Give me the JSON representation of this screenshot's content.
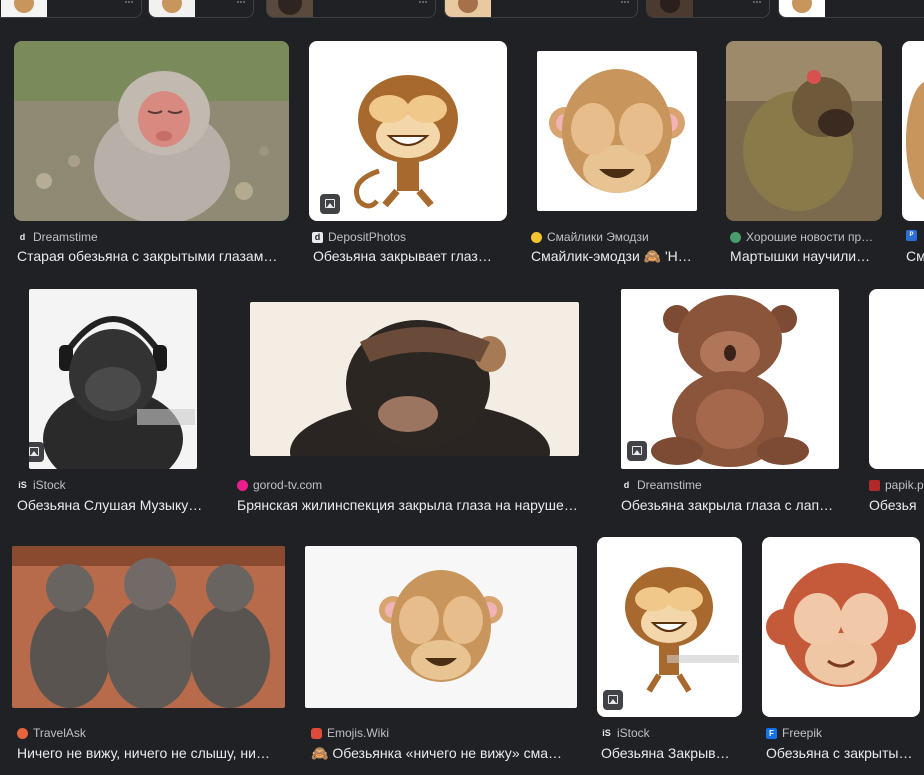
{
  "colors": {
    "background": "#202124",
    "text_primary": "#e8eaed",
    "text_secondary": "#bdc1c6"
  },
  "results": [
    {
      "source": "Dreamstime",
      "icon": "dreamstime-logo-icon",
      "title": "Старая обезьяна с закрытыми глазам…"
    },
    {
      "source": "DepositPhotos",
      "icon": "depositphotos-logo-icon",
      "title": "Обезьяна закрывает глаз…"
    },
    {
      "source": "Смайлики Эмодзи",
      "icon": "smiley-emoji-icon",
      "title": "Смайлик-эмодзи 🙈 'Н…"
    },
    {
      "source": "Хорошие новости пр…",
      "icon": "globe-icon",
      "title": "Мартышки научили…"
    },
    {
      "source": "",
      "icon": "png-logo-icon",
      "title": "См"
    },
    {
      "source": "iStock",
      "icon": "istock-logo-icon",
      "title": "Обезьяна Слушая Музыку…"
    },
    {
      "source": "gorod-tv.com",
      "icon": "pink-dot-icon",
      "title": "Брянская жилинспекция закрыла глаза на наруше…"
    },
    {
      "source": "Dreamstime",
      "icon": "dreamstime-logo-icon",
      "title": "Обезьяна закрыла глаза с лап…"
    },
    {
      "source": "papik.p",
      "icon": "papik-logo-icon",
      "title": "Обезья"
    },
    {
      "source": "TravelAsk",
      "icon": "travelask-logo-icon",
      "title": "Ничего не вижу, ничего не слышу, ни…"
    },
    {
      "source": "Emojis.Wiki",
      "icon": "emojis-wiki-icon",
      "title": "🙈 Обезьянка «ничего не вижу» сма…"
    },
    {
      "source": "iStock",
      "icon": "istock-logo-icon",
      "title": "Обезьяна Закрыв…"
    },
    {
      "source": "Freepik",
      "icon": "freepik-logo-icon",
      "title": "Обезьяна с закрыты…"
    }
  ]
}
